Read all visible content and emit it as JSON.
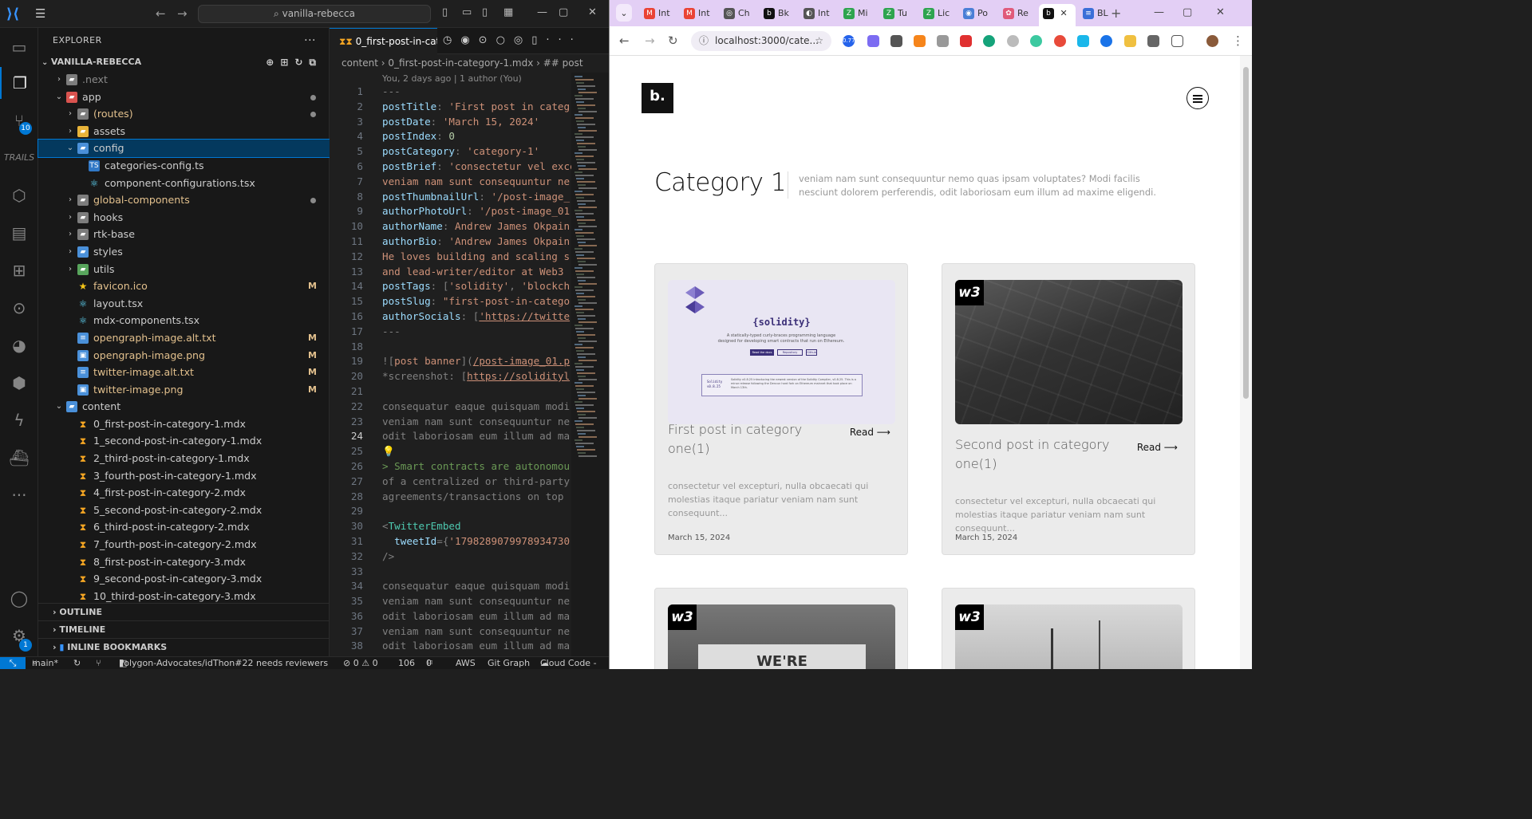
{
  "vscode": {
    "search": "vanilla-rebecca",
    "explorer_title": "EXPLORER",
    "project": "VANILLA-REBECCA",
    "scm_badge": "10",
    "settings_badge": "1",
    "tree": [
      {
        "label": ".next",
        "indent": 1,
        "chev": "›",
        "icon": "folder",
        "color": "#8a8a8a",
        "status": ""
      },
      {
        "label": "app",
        "indent": 1,
        "chev": "⌄",
        "icon": "folder-red",
        "color": "#cccccc",
        "status": "dot"
      },
      {
        "label": "(routes)",
        "indent": 2,
        "chev": "›",
        "icon": "folder",
        "color": "#e2c08d",
        "status": "dot"
      },
      {
        "label": "assets",
        "indent": 2,
        "chev": "›",
        "icon": "folder-yellow",
        "color": "#cccccc",
        "status": ""
      },
      {
        "label": "config",
        "indent": 2,
        "chev": "⌄",
        "icon": "folder-blue",
        "color": "#cccccc",
        "status": "",
        "selected": true
      },
      {
        "label": "categories-config.ts",
        "indent": 3,
        "chev": "",
        "icon": "ts",
        "color": "#cccccc",
        "status": ""
      },
      {
        "label": "component-configurations.tsx",
        "indent": 3,
        "chev": "",
        "icon": "react",
        "color": "#cccccc",
        "status": ""
      },
      {
        "label": "global-components",
        "indent": 2,
        "chev": "›",
        "icon": "folder",
        "color": "#e2c08d",
        "status": "dot"
      },
      {
        "label": "hooks",
        "indent": 2,
        "chev": "›",
        "icon": "folder",
        "color": "#cccccc",
        "status": ""
      },
      {
        "label": "rtk-base",
        "indent": 2,
        "chev": "›",
        "icon": "folder",
        "color": "#cccccc",
        "status": ""
      },
      {
        "label": "styles",
        "indent": 2,
        "chev": "›",
        "icon": "folder-blue",
        "color": "#cccccc",
        "status": ""
      },
      {
        "label": "utils",
        "indent": 2,
        "chev": "›",
        "icon": "folder-green",
        "color": "#cccccc",
        "status": ""
      },
      {
        "label": "favicon.ico",
        "indent": 2,
        "chev": "",
        "icon": "star",
        "color": "#e2c08d",
        "status": "M"
      },
      {
        "label": "layout.tsx",
        "indent": 2,
        "chev": "",
        "icon": "react",
        "color": "#cccccc",
        "status": ""
      },
      {
        "label": "mdx-components.tsx",
        "indent": 2,
        "chev": "",
        "icon": "react",
        "color": "#cccccc",
        "status": ""
      },
      {
        "label": "opengraph-image.alt.txt",
        "indent": 2,
        "chev": "",
        "icon": "txt",
        "color": "#e2c08d",
        "status": "M"
      },
      {
        "label": "opengraph-image.png",
        "indent": 2,
        "chev": "",
        "icon": "img",
        "color": "#e2c08d",
        "status": "M"
      },
      {
        "label": "twitter-image.alt.txt",
        "indent": 2,
        "chev": "",
        "icon": "txt",
        "color": "#e2c08d",
        "status": "M"
      },
      {
        "label": "twitter-image.png",
        "indent": 2,
        "chev": "",
        "icon": "img",
        "color": "#e2c08d",
        "status": "M"
      },
      {
        "label": "content",
        "indent": 1,
        "chev": "⌄",
        "icon": "folder-blue",
        "color": "#cccccc",
        "status": ""
      },
      {
        "label": "0_first-post-in-category-1.mdx",
        "indent": 2,
        "chev": "",
        "icon": "mdx",
        "color": "#cccccc",
        "status": ""
      },
      {
        "label": "1_second-post-in-category-1.mdx",
        "indent": 2,
        "chev": "",
        "icon": "mdx",
        "color": "#cccccc",
        "status": ""
      },
      {
        "label": "2_third-post-in-category-1.mdx",
        "indent": 2,
        "chev": "",
        "icon": "mdx",
        "color": "#cccccc",
        "status": ""
      },
      {
        "label": "3_fourth-post-in-category-1.mdx",
        "indent": 2,
        "chev": "",
        "icon": "mdx",
        "color": "#cccccc",
        "status": ""
      },
      {
        "label": "4_first-post-in-category-2.mdx",
        "indent": 2,
        "chev": "",
        "icon": "mdx",
        "color": "#cccccc",
        "status": ""
      },
      {
        "label": "5_second-post-in-category-2.mdx",
        "indent": 2,
        "chev": "",
        "icon": "mdx",
        "color": "#cccccc",
        "status": ""
      },
      {
        "label": "6_third-post-in-category-2.mdx",
        "indent": 2,
        "chev": "",
        "icon": "mdx",
        "color": "#cccccc",
        "status": ""
      },
      {
        "label": "7_fourth-post-in-category-2.mdx",
        "indent": 2,
        "chev": "",
        "icon": "mdx",
        "color": "#cccccc",
        "status": ""
      },
      {
        "label": "8_first-post-in-category-3.mdx",
        "indent": 2,
        "chev": "",
        "icon": "mdx",
        "color": "#cccccc",
        "status": ""
      },
      {
        "label": "9_second-post-in-category-3.mdx",
        "indent": 2,
        "chev": "",
        "icon": "mdx",
        "color": "#cccccc",
        "status": ""
      },
      {
        "label": "10_third-post-in-category-3.mdx",
        "indent": 2,
        "chev": "",
        "icon": "mdx",
        "color": "#cccccc",
        "status": ""
      }
    ],
    "sections": [
      "OUTLINE",
      "TIMELINE",
      "INLINE BOOKMARKS"
    ],
    "tab_label": "0_first-post-in-cat",
    "breadcrumb": "content  ›  0_first-post-in-category-1.mdx  ›  ## post",
    "blame": "You, 2 days ago | 1 author (You)",
    "current_line": 24,
    "code": [
      [
        [
          "p",
          "---"
        ]
      ],
      [
        [
          "k",
          "postTitle"
        ],
        [
          "p",
          ": "
        ],
        [
          "s",
          "'First post in categ"
        ]
      ],
      [
        [
          "k",
          "postDate"
        ],
        [
          "p",
          ": "
        ],
        [
          "s",
          "'March 15, 2024'"
        ]
      ],
      [
        [
          "k",
          "postIndex"
        ],
        [
          "p",
          ": "
        ],
        [
          "n",
          "0"
        ]
      ],
      [
        [
          "k",
          "postCategory"
        ],
        [
          "p",
          ": "
        ],
        [
          "s",
          "'category-1'"
        ]
      ],
      [
        [
          "k",
          "postBrief"
        ],
        [
          "p",
          ": "
        ],
        [
          "s",
          "'consectetur vel exce"
        ]
      ],
      [
        [
          "s",
          "veniam nam sunt consequuntur ne"
        ]
      ],
      [
        [
          "k",
          "postThumbnailUrl"
        ],
        [
          "p",
          ": "
        ],
        [
          "s",
          "'/post-image_"
        ]
      ],
      [
        [
          "k",
          "authorPhotoUrl"
        ],
        [
          "p",
          ": "
        ],
        [
          "s",
          "'/post-image_01"
        ]
      ],
      [
        [
          "k",
          "authorName"
        ],
        [
          "p",
          ": "
        ],
        [
          "s",
          "Andrew James Okpain"
        ]
      ],
      [
        [
          "k",
          "authorBio"
        ],
        [
          "p",
          ": "
        ],
        [
          "s",
          "'Andrew James Okpain"
        ]
      ],
      [
        [
          "s",
          "He loves building and scaling s"
        ]
      ],
      [
        [
          "s",
          "and lead-writer/editor at Web3 "
        ]
      ],
      [
        [
          "k",
          "postTags"
        ],
        [
          "p",
          ": ["
        ],
        [
          "s",
          "'solidity'"
        ],
        [
          "p",
          ", "
        ],
        [
          "s",
          "'blockch"
        ]
      ],
      [
        [
          "k",
          "postSlug"
        ],
        [
          "p",
          ": "
        ],
        [
          "s",
          "\"first-post-in-catego"
        ]
      ],
      [
        [
          "k",
          "authorSocials"
        ],
        [
          "p",
          ": ["
        ],
        [
          "u",
          "'https://twitte"
        ]
      ],
      [
        [
          "p",
          "---"
        ]
      ],
      [
        [
          "p",
          ""
        ]
      ],
      [
        [
          "p",
          "!["
        ],
        [
          "s",
          "post banner"
        ],
        [
          "p",
          "]("
        ],
        [
          "u",
          "/post-image_01.p"
        ]
      ],
      [
        [
          "p",
          "*screenshot: ["
        ],
        [
          "u",
          "https://solidityl"
        ]
      ],
      [
        [
          "p",
          ""
        ]
      ],
      [
        [
          "p",
          "consequatur eaque quisquam modi"
        ]
      ],
      [
        [
          "p",
          "veniam nam sunt consequuntur ne"
        ]
      ],
      [
        [
          "p",
          "odit laboriosam eum illum ad ma"
        ]
      ],
      [
        [
          "y",
          "💡"
        ]
      ],
      [
        [
          "g",
          "> Smart contracts are autonomou"
        ]
      ],
      [
        [
          "p",
          "of a centralized or third-party"
        ]
      ],
      [
        [
          "p",
          "agreements/transactions on top "
        ]
      ],
      [
        [
          "p",
          ""
        ]
      ],
      [
        [
          "p",
          "<"
        ],
        [
          "t",
          "TwitterEmbed"
        ]
      ],
      [
        [
          "k",
          "  tweetId"
        ],
        [
          "p",
          "={"
        ],
        [
          "s",
          "'1798289079978934730"
        ]
      ],
      [
        [
          "p",
          "/>"
        ]
      ],
      [
        [
          "p",
          ""
        ]
      ],
      [
        [
          "p",
          "consequatur eaque quisquam modi"
        ]
      ],
      [
        [
          "p",
          "veniam nam sunt consequuntur ne"
        ]
      ],
      [
        [
          "p",
          "odit laboriosam eum illum ad ma"
        ]
      ],
      [
        [
          "p",
          "veniam nam sunt consequuntur ne"
        ]
      ],
      [
        [
          "p",
          "odit laboriosam eum illum ad ma"
        ]
      ]
    ],
    "status": {
      "branch": "main*",
      "pr": "Polygon-Advocates/idThon#22 needs reviewers",
      "problems": "⊘ 0 ⚠ 0",
      "count": "106",
      "ports": "0",
      "aws": "AWS",
      "graph": "Git Graph",
      "cloud": "Cloud Code -"
    }
  },
  "browser": {
    "tabs": [
      {
        "label": "Int",
        "fav": "M",
        "color": "#ea4335"
      },
      {
        "label": "Int",
        "fav": "M",
        "color": "#ea4335"
      },
      {
        "label": "Ch",
        "fav": "◎",
        "color": "#555555"
      },
      {
        "label": "Bk",
        "fav": "b",
        "color": "#111111"
      },
      {
        "label": "Int",
        "fav": "◐",
        "color": "#555555"
      },
      {
        "label": "Mi",
        "fav": "Z",
        "color": "#2ea44f"
      },
      {
        "label": "Tu",
        "fav": "Z",
        "color": "#2ea44f"
      },
      {
        "label": "Lic",
        "fav": "Z",
        "color": "#2ea44f"
      },
      {
        "label": "Po",
        "fav": "◉",
        "color": "#4a7fd6"
      },
      {
        "label": "Re",
        "fav": "✿",
        "color": "#e05a7a"
      },
      {
        "label": "",
        "fav": "b",
        "color": "#111111",
        "active": true
      },
      {
        "label": "BL",
        "fav": "≡",
        "color": "#3b6fd8"
      }
    ],
    "url": "localhost:3000/cate...",
    "ext_badge": "0.77",
    "page": {
      "logo": "b.",
      "category_title": "Category 1",
      "category_desc": "veniam nam sunt consequuntur nemo quas ipsam voluptates? Modi facilis nesciunt dolorem perferendis, odit laboriosam eum illum ad maxime eligendi.",
      "cards": [
        {
          "title": "First post in category one(1)",
          "read": "Read",
          "brief": "consectetur vel excepturi, nulla obcaecati qui molestias itaque pariatur veniam nam sunt consequunt...",
          "date": "March 15, 2024",
          "thumb": "solidity"
        },
        {
          "title": "Second post in category one(1)",
          "read": "Read",
          "brief": "consectetur vel excepturi, nulla obcaecati qui molestias itaque pariatur veniam nam sunt consequunt...",
          "date": "March 15, 2024",
          "thumb": "keyboard"
        },
        {
          "title": "",
          "read": "",
          "brief": "",
          "date": "",
          "thumb": "office"
        },
        {
          "title": "",
          "read": "",
          "brief": "",
          "date": "",
          "thumb": "studio"
        }
      ],
      "solidity_thumb": {
        "heading": "{solidity}",
        "tagline": "A statically-typed curly-braces programming language designed for developing smart contracts that run on Ethereum.",
        "btn1": "Read the docs",
        "btn2": "Repository",
        "btn3": "Github",
        "box_left": "Solidity v0.8.25",
        "box_right": "Solidity v0.8.25 introducing the newest version of the Solidity Compiler, v0.8.25. This is a minor release following the Dencun hard fork on Ethereum mainnet that took place on March 13th."
      },
      "w3": "w3",
      "office_sign": "WE'RE"
    }
  }
}
